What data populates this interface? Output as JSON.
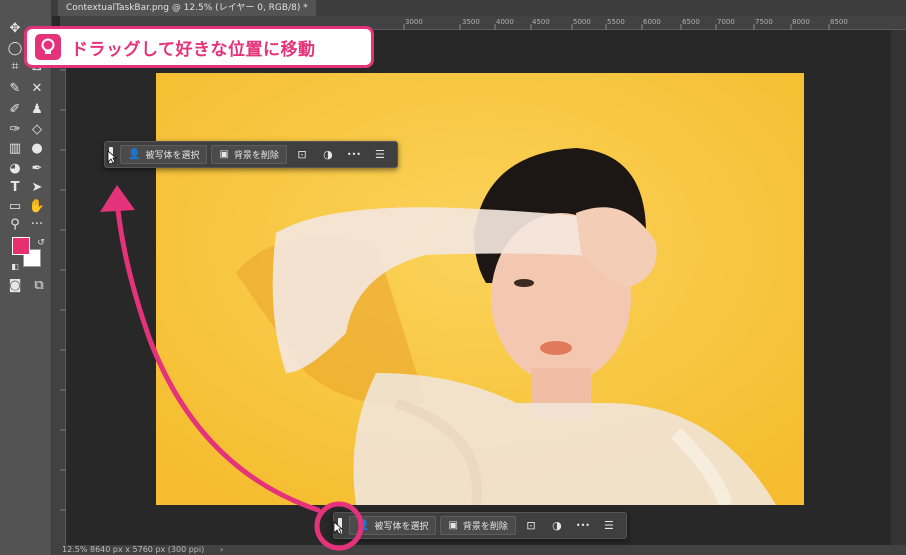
{
  "document": {
    "tab_title": "ContextualTaskBar.png @ 12.5% (レイヤー 0, RGB/8) *"
  },
  "ruler": {
    "top_ticks": [
      "3000",
      "3500",
      "4000",
      "4500",
      "5000",
      "5500",
      "6000",
      "6500",
      "7000",
      "7500",
      "8000",
      "8500"
    ]
  },
  "status": {
    "zoom": "12.5%",
    "doc_info": "8640 px x 5760 px (300 ppi)",
    "arrow": "›"
  },
  "callout": {
    "text": "ドラッグして好きな位置に移動",
    "color": "#e4337a"
  },
  "taskbar": {
    "select_subject_label": "被写体を選択",
    "remove_bg_label": "背景を削除",
    "more_label": "•••"
  },
  "colors": {
    "foreground": "#e8306e",
    "background": "#ffffff",
    "photo_background": "#f8c53d",
    "accent": "#e4337a"
  }
}
